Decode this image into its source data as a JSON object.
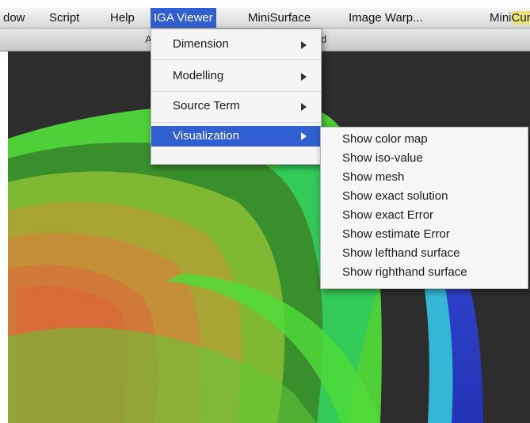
{
  "menubar": {
    "items": [
      {
        "label": "dow"
      },
      {
        "label": "Script"
      },
      {
        "label": "Help"
      },
      {
        "label": "IGA Viewer",
        "active": true
      },
      {
        "label": "MiniSurface"
      },
      {
        "label": "Image Warp..."
      }
    ],
    "cut_item": {
      "prefix": "Mini",
      "suffix": "Curve"
    }
  },
  "titlebar": {
    "frag_left": "A",
    "frag_right": "d"
  },
  "dropdown": {
    "items": [
      {
        "label": "Dimension",
        "has_submenu": true
      },
      {
        "label": "Modelling",
        "has_submenu": true
      },
      {
        "label": "Source Term",
        "has_submenu": true
      },
      {
        "label": "Visualization",
        "has_submenu": true,
        "active": true
      }
    ]
  },
  "submenu": {
    "items": [
      "Show color map",
      "Show iso-value",
      "Show mesh",
      "Show exact solution",
      "Show exact Error",
      "Show estimate Error",
      "Show lefthand surface",
      "Show righthand surface"
    ]
  },
  "colors": {
    "highlight": "#2f5fd0",
    "canvas_bg": "#2d2d2d",
    "surface_green": "#3fd13a",
    "surface_orange": "#d9783a"
  }
}
